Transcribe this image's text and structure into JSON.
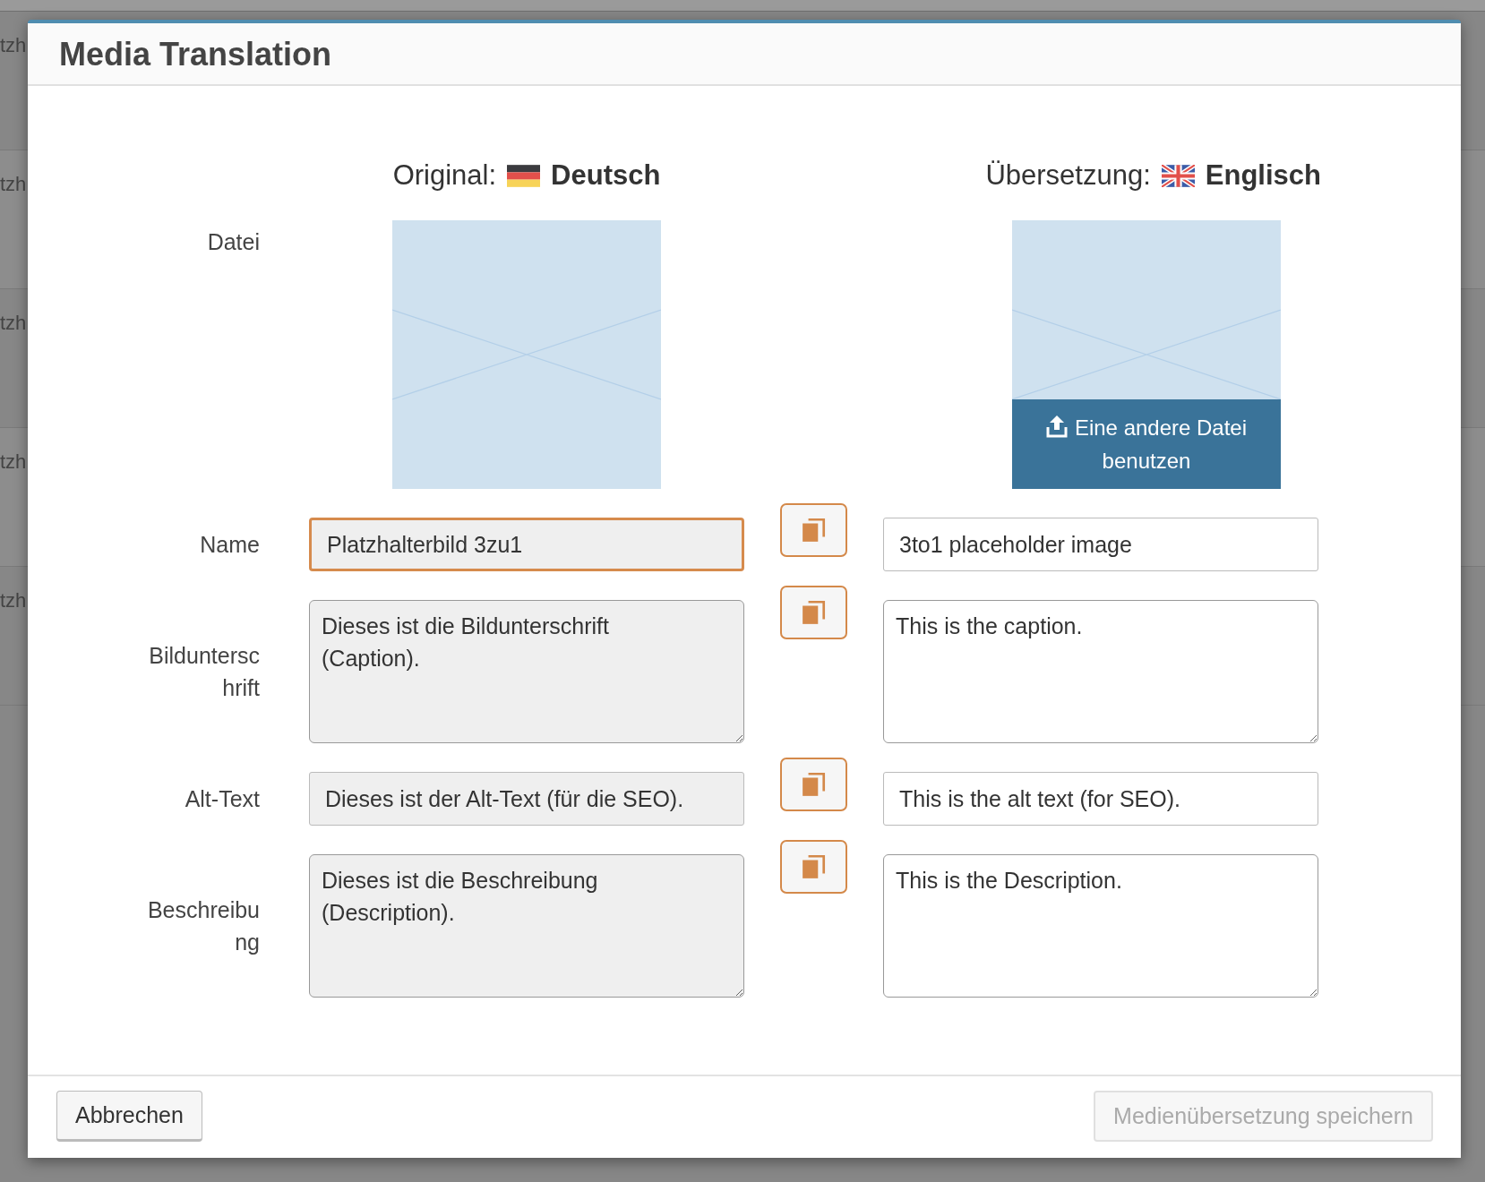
{
  "background_rows": [
    {
      "text": "tzh"
    },
    {
      "text": "tzh"
    },
    {
      "text": "tzh"
    },
    {
      "text": "tzh"
    },
    {
      "text": "tzh"
    }
  ],
  "dialog": {
    "title": "Media Translation",
    "original": {
      "kind": "original",
      "label": "Original:",
      "language": "Deutsch"
    },
    "translation": {
      "kind": "translation",
      "label": "Übersetzung:",
      "language": "Englisch"
    },
    "file_label": "Datei",
    "upload_button": "Eine andere Datei benutzen",
    "fields": [
      {
        "kind": "input",
        "label": "Name",
        "original": "Platzhalterbild 3zu1",
        "translation": "3to1 placeholder image",
        "focused": true
      },
      {
        "kind": "textarea",
        "label": "Bildunterschrift",
        "original": "Dieses ist die Bildunterschrift (Caption).",
        "translation": "This is the caption.",
        "focused": false
      },
      {
        "kind": "input",
        "label": "Alt-Text",
        "original": "Dieses ist der Alt-Text (für die SEO).",
        "translation": "This is the alt text (for SEO).",
        "focused": false
      },
      {
        "kind": "textarea",
        "label": "Beschreibung",
        "original": "Dieses ist die Beschreibung (Description).",
        "translation": "This is the Description.",
        "focused": false
      }
    ],
    "buttons": [
      {
        "kind": "cancel",
        "label": "Abbrechen",
        "disabled": false
      },
      {
        "kind": "save",
        "label": "Medienübersetzung speichern",
        "disabled": true
      }
    ]
  }
}
